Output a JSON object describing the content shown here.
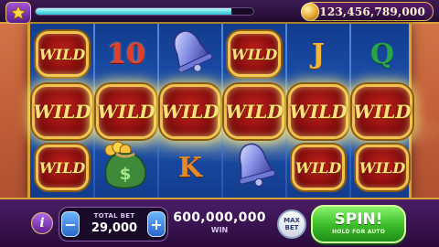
{
  "header": {
    "coins": "$123,456,789,000",
    "xp_progress": 0.9,
    "icons": [
      "star-icon",
      "coin-icon"
    ]
  },
  "reels": {
    "columns": 6,
    "rows": 3,
    "symbols": [
      [
        "WILD",
        "WILD",
        "WILD"
      ],
      [
        "10",
        "WILD",
        "money-bag"
      ],
      [
        "bell",
        "WILD",
        "K"
      ],
      [
        "WILD",
        "WILD",
        "bell"
      ],
      [
        "J",
        "WILD",
        "WILD"
      ],
      [
        "Q",
        "WILD",
        "WILD"
      ]
    ],
    "wild_label": "WILD",
    "ten_label": "10",
    "j_label": "J",
    "q_label": "Q",
    "k_label": "K",
    "winning_row": 2
  },
  "controls": {
    "info_label": "i",
    "minus_label": "−",
    "plus_label": "+",
    "total_bet_label": "TOTAL BET",
    "total_bet_value": "29,000",
    "win_value": "600,000,000",
    "win_label": "WIN",
    "max_bet_line1": "MAX",
    "max_bet_line2": "BET",
    "spin_label": "SPIN!",
    "spin_sub": "HOLD FOR AUTO"
  },
  "colors": {
    "wild_red": "#c9251b",
    "gold": "#f1c24e",
    "spin_green": "#3fc02c",
    "reel_blue": "#1e55b6",
    "purple_bar": "#4a1d66"
  }
}
